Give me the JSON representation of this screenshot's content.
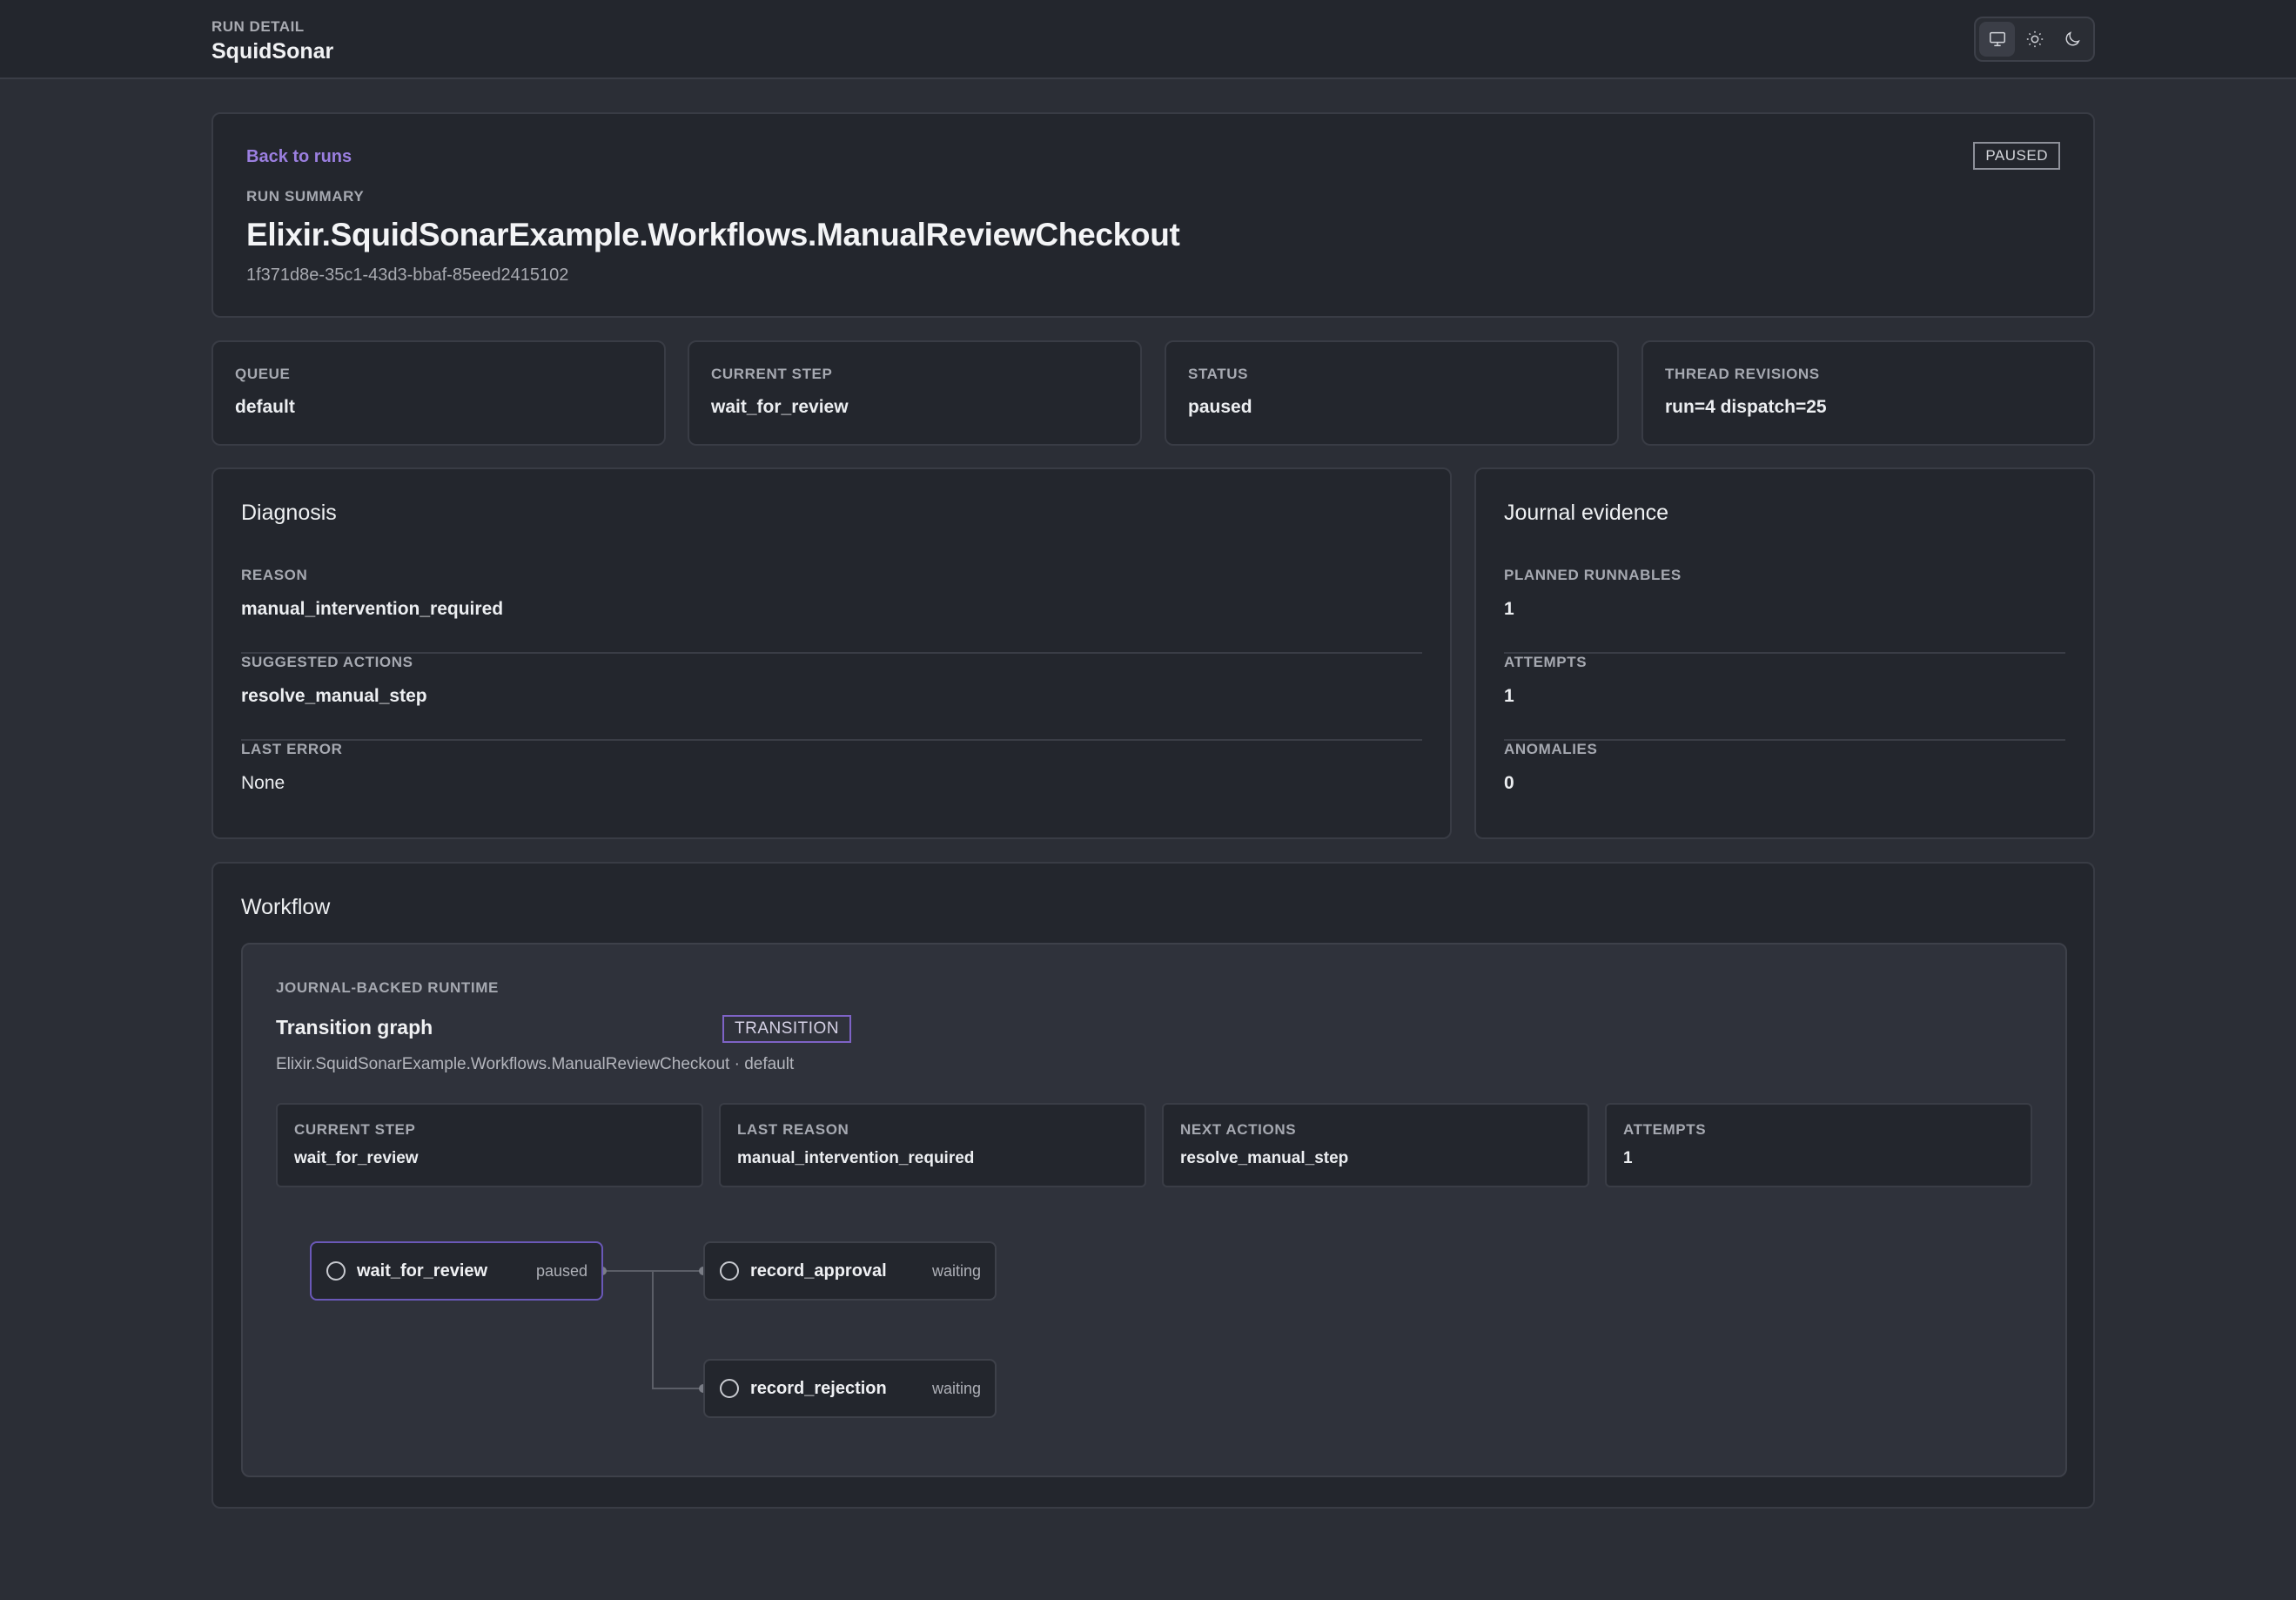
{
  "header": {
    "eyebrow": "RUN DETAIL",
    "title": "SquidSonar",
    "theme_icons": [
      "monitor-icon",
      "sun-icon",
      "moon-icon"
    ]
  },
  "summary": {
    "back_link": "Back to runs",
    "label": "RUN SUMMARY",
    "title": "Elixir.SquidSonarExample.Workflows.ManualReviewCheckout",
    "id": "1f371d8e-35c1-43d3-bbaf-85eed2415102",
    "status": "PAUSED"
  },
  "stats": [
    {
      "label": "QUEUE",
      "value": "default"
    },
    {
      "label": "CURRENT STEP",
      "value": "wait_for_review"
    },
    {
      "label": "STATUS",
      "value": "paused"
    },
    {
      "label": "THREAD REVISIONS",
      "value": "run=4 dispatch=25"
    }
  ],
  "diagnosis": {
    "title": "Diagnosis",
    "rows": [
      {
        "label": "REASON",
        "value": "manual_intervention_required"
      },
      {
        "label": "SUGGESTED ACTIONS",
        "value": "resolve_manual_step"
      },
      {
        "label": "LAST ERROR",
        "value": "None"
      }
    ]
  },
  "journal": {
    "title": "Journal evidence",
    "rows": [
      {
        "label": "PLANNED RUNNABLES",
        "value": "1"
      },
      {
        "label": "ATTEMPTS",
        "value": "1"
      },
      {
        "label": "ANOMALIES",
        "value": "0"
      }
    ]
  },
  "workflow": {
    "title": "Workflow",
    "runtime_label": "JOURNAL-BACKED RUNTIME",
    "graph_title": "Transition graph",
    "badge": "TRANSITION",
    "subtitle": "Elixir.SquidSonarExample.Workflows.ManualReviewCheckout · default",
    "stats": [
      {
        "label": "CURRENT STEP",
        "value": "wait_for_review"
      },
      {
        "label": "LAST REASON",
        "value": "manual_intervention_required"
      },
      {
        "label": "NEXT ACTIONS",
        "value": "resolve_manual_step"
      },
      {
        "label": "ATTEMPTS",
        "value": "1"
      }
    ],
    "nodes": [
      {
        "name": "wait_for_review",
        "state": "paused"
      },
      {
        "name": "record_approval",
        "state": "waiting"
      },
      {
        "name": "record_rejection",
        "state": "waiting"
      }
    ]
  },
  "colors": {
    "accent": "#9b7fe0",
    "background": "#2b2e36",
    "card": "#23262d"
  }
}
